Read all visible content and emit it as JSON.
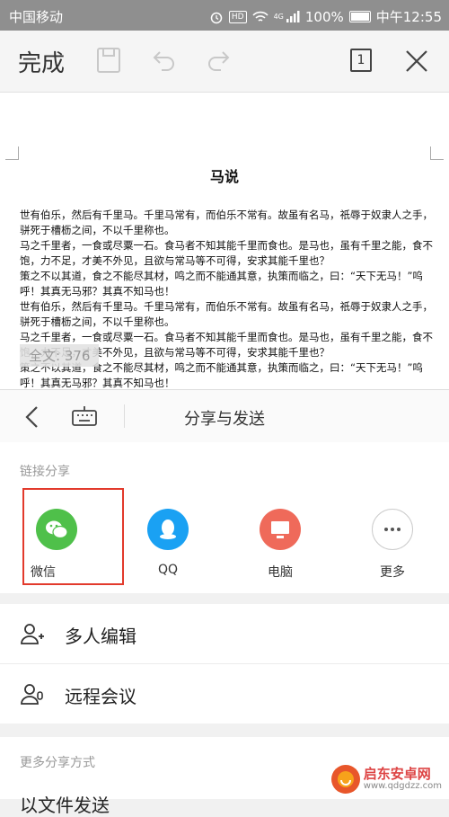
{
  "status_bar": {
    "carrier": "中国移动",
    "network": "4G",
    "battery": "100%",
    "time": "中午12:55"
  },
  "toolbar": {
    "done_label": "完成",
    "page_count": "1"
  },
  "document": {
    "title": "马说",
    "paragraphs": [
      "世有伯乐，然后有千里马。千里马常有，而伯乐不常有。故虽有名马，祇辱于奴隶人之手，骈死于槽枥之间，不以千里称也。",
      "马之千里者，一食或尽粟一石。食马者不知其能千里而食也。是马也，虽有千里之能，食不饱，力不足，才美不外见，且欲与常马等不可得，安求其能千里也？",
      "策之不以其道，食之不能尽其材，鸣之而不能通其意，执策而临之，曰：“天下无马！”呜呼！其真无马邪？其真不知马也！",
      "世有伯乐，然后有千里马。千里马常有，而伯乐不常有。故虽有名马，祇辱于奴隶人之手，骈死于槽枥之间，不以千里称也。",
      "马之千里者，一食或尽粟一石。食马者不知其能千里而食也。是马也，虽有千里之能，食不饱，力不足，才美不外见，且欲与常马等不可得，安求其能千里也？",
      "策之不以其道，食之不能尽其材，鸣之而不能通其意，执策而临之，曰：“天下无马！”呜呼！其真无马邪？其真不知马也！"
    ],
    "word_count": "全文: 376"
  },
  "share": {
    "title": "分享与发送",
    "link_section_label": "链接分享",
    "targets": [
      {
        "label": "微信",
        "icon": "wechat-icon",
        "color": "#4fc04a"
      },
      {
        "label": "QQ",
        "icon": "qq-icon",
        "color": "#1aa1f3"
      },
      {
        "label": "电脑",
        "icon": "computer-icon",
        "color": "#ef6a5a"
      },
      {
        "label": "更多",
        "icon": "more-icon",
        "color": "#ffffff"
      }
    ],
    "actions": [
      {
        "label": "多人编辑",
        "icon": "add-user-icon"
      },
      {
        "label": "远程会议",
        "icon": "meeting-icon"
      }
    ],
    "more_section_label": "更多分享方式",
    "partial_row_label": "以文件发送"
  },
  "watermark": {
    "name": "启东安卓网",
    "url": "www.qdgdzz.com"
  },
  "colors": {
    "highlight": "#e23a2c",
    "status_bar": "#8f8f8f"
  }
}
